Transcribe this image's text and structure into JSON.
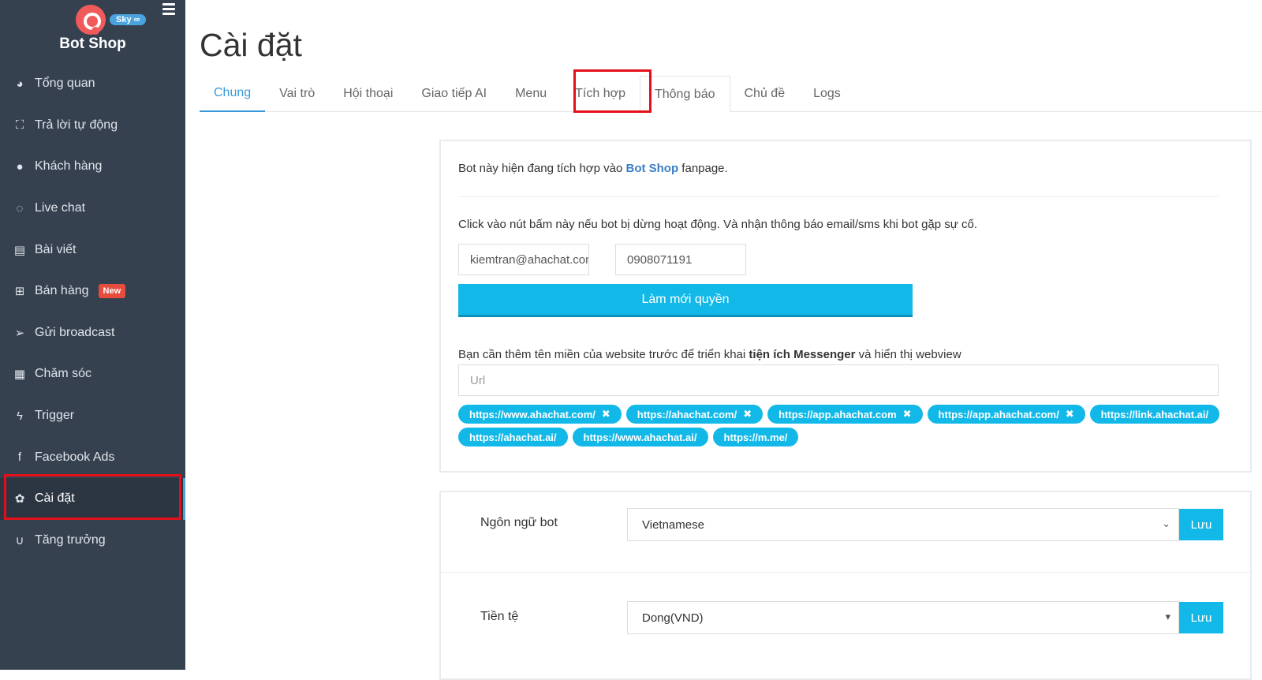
{
  "brand": {
    "name": "Bot Shop",
    "plan_badge": "Sky ∞"
  },
  "sidebar": {
    "items": [
      {
        "label": "Tổng quan",
        "icon": "dashboard-icon",
        "glyph": "◕"
      },
      {
        "label": "Trả lời tự động",
        "icon": "sitemap-icon",
        "glyph": "⛶"
      },
      {
        "label": "Khách hàng",
        "icon": "user-icon",
        "glyph": "●"
      },
      {
        "label": "Live chat",
        "icon": "chat-icon",
        "glyph": "◌"
      },
      {
        "label": "Bài viết",
        "icon": "book-icon",
        "glyph": "▤"
      },
      {
        "label": "Bán hàng",
        "icon": "cart-icon",
        "glyph": "⊞",
        "badge": "New"
      },
      {
        "label": "Gửi broadcast",
        "icon": "paper-plane-icon",
        "glyph": "➢"
      },
      {
        "label": "Chăm sóc",
        "icon": "calendar-icon",
        "glyph": "▦"
      },
      {
        "label": "Trigger",
        "icon": "bolt-icon",
        "glyph": "ϟ"
      },
      {
        "label": "Facebook Ads",
        "icon": "facebook-icon",
        "glyph": "f"
      },
      {
        "label": "Cài đặt",
        "icon": "gear-icon",
        "glyph": "✿",
        "active": true
      },
      {
        "label": "Tăng trưởng",
        "icon": "magnet-icon",
        "glyph": "∪"
      }
    ]
  },
  "page": {
    "title": "Cài đặt"
  },
  "tabs": [
    "Chung",
    "Vai trò",
    "Hội thoại",
    "Giao tiếp AI",
    "Menu",
    "Tích hợp",
    "Thông báo",
    "Chủ đề",
    "Logs"
  ],
  "integration": {
    "intro_prefix": "Bot này hiện đang tích hợp vào ",
    "intro_link": "Bot Shop",
    "intro_suffix": " fanpage.",
    "refresh_note": "Click vào nút bấm này nếu bot bị dừng hoạt động. Và nhận thông báo email/sms khi bot gặp sự cố.",
    "email_value": "kiemtran@ahachat.com",
    "phone_value": "0908071191",
    "refresh_button": "Làm mới quyền",
    "domain_note_prefix": "Bạn cần thêm tên miền của website trước để triển khai ",
    "domain_note_bold": "tiện ích Messenger",
    "domain_note_suffix": " và hiển thị webview",
    "url_placeholder": "Url",
    "domains": [
      "https://www.ahachat.com/",
      "https://ahachat.com/",
      "https://app.ahachat.com",
      "https://app.ahachat.com/",
      "https://link.ahachat.ai/",
      "https://ahachat.ai/",
      "https://www.ahachat.ai/",
      "https://m.me/"
    ]
  },
  "settings": {
    "language_label": "Ngôn ngữ bot",
    "language_value": "Vietnamese",
    "currency_label": "Tiền tệ",
    "currency_value": "Dong(VND)",
    "save_label": "Lưu"
  },
  "colors": {
    "sidebar_bg": "#364150",
    "accent": "#12b9e8",
    "link": "#3a7fc4",
    "highlight": "#e3101b",
    "new_badge": "#e74c3c"
  }
}
